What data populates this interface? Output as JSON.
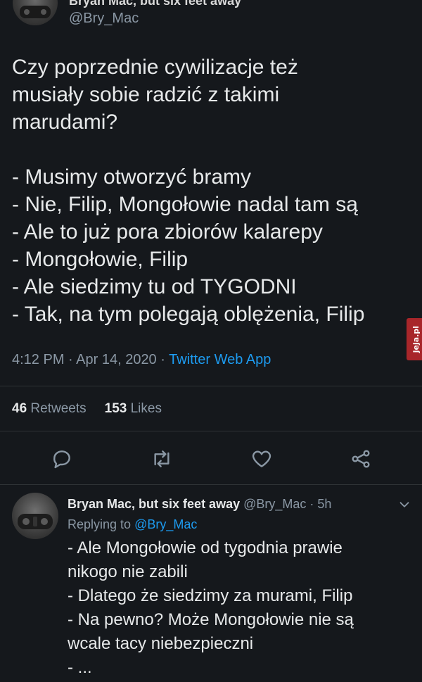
{
  "author": {
    "name": "Bryan Mac, but six feet away",
    "handle": "@Bry_Mac"
  },
  "tweet": {
    "lines": [
      "Czy poprzednie cywilizacje też",
      "musiały sobie radzić z takimi",
      "marudami?",
      "",
      "- Musimy otworzyć bramy",
      "- Nie, Filip, Mongołowie nadal tam są",
      "- Ale to już pora zbiorów kalarepy",
      "- Mongołowie, Filip",
      "- Ale siedzimy tu od TYGODNI",
      "- Tak, na tym polegają oblężenia, Filip"
    ],
    "time": "4:12 PM · Apr 14, 2020 · ",
    "source": "Twitter Web App"
  },
  "stats": {
    "retweets_count": "46",
    "retweets_label": " Retweets",
    "likes_count": "153",
    "likes_label": " Likes"
  },
  "icons": {
    "reply": "reply-icon",
    "retweet": "retweet-icon",
    "like": "heart-icon",
    "share": "share-icon",
    "more": "chevron-down-icon"
  },
  "reply": {
    "name": "Bryan Mac, but six feet away",
    "handle_time": " @Bry_Mac · 5h",
    "replying_prefix": "Replying to ",
    "replying_mention": "@Bry_Mac",
    "lines": [
      "- Ale Mongołowie od tygodnia prawie",
      "nikogo nie zabili",
      "- Dlatego że siedzimy za murami, Filip",
      "- Na pewno? Może Mongołowie nie są",
      "wcale tacy niebezpieczni",
      "- ..."
    ]
  },
  "watermark": "jeja.pl",
  "colors": {
    "background": "#15181c",
    "text": "#e7e9ea",
    "secondary": "#8b98a5",
    "link": "#1d9bf0",
    "divider": "#2f3336"
  }
}
